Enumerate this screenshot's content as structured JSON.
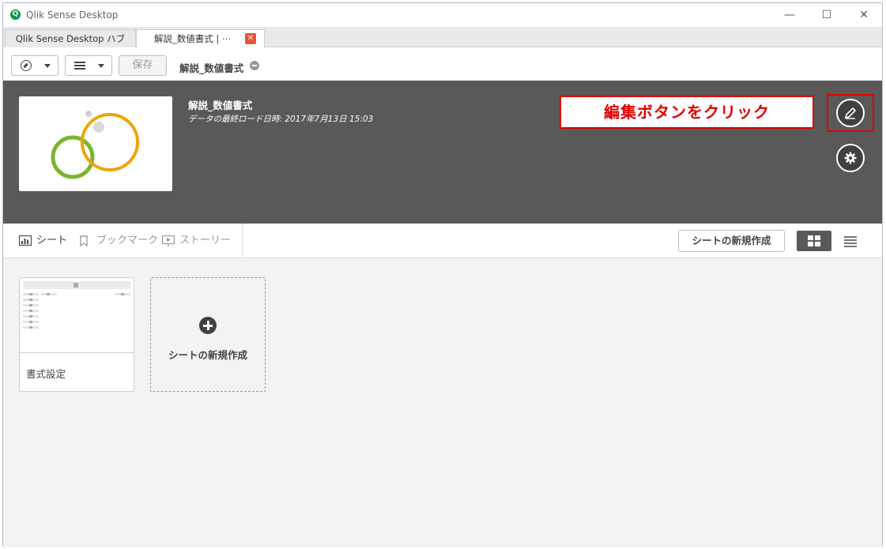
{
  "window": {
    "title": "Qlik Sense Desktop",
    "app_icon": "qlik-logo-icon"
  },
  "tabs": [
    {
      "label": "Qlik Sense Desktop ハブ",
      "active": false
    },
    {
      "label": "解説_数値書式 | ⋯",
      "active": true,
      "close_icon": "close-icon",
      "close_color": "#e7543c"
    }
  ],
  "toolbar": {
    "save_label": "保存",
    "app_title": "解説_数値書式"
  },
  "app_header": {
    "name": "解説_数値書式",
    "reload_text": "データの最終ロード日時: 2017年7月13日 15:03",
    "background": "#595959"
  },
  "annotation": {
    "text": "編集ボタンをクリック",
    "color": "#e00000"
  },
  "sheet_tabs": {
    "sheet": "シート",
    "bookmark": "ブックマーク",
    "story": "ストーリー"
  },
  "new_sheet_button": "シートの新規作成",
  "sheets": [
    {
      "title": "書式設定"
    }
  ],
  "create_card_label": "シートの新規作成",
  "colors": {
    "accent_green": "#7ab52d",
    "accent_orange": "#f0a30a",
    "qlik_green": "#009845"
  }
}
